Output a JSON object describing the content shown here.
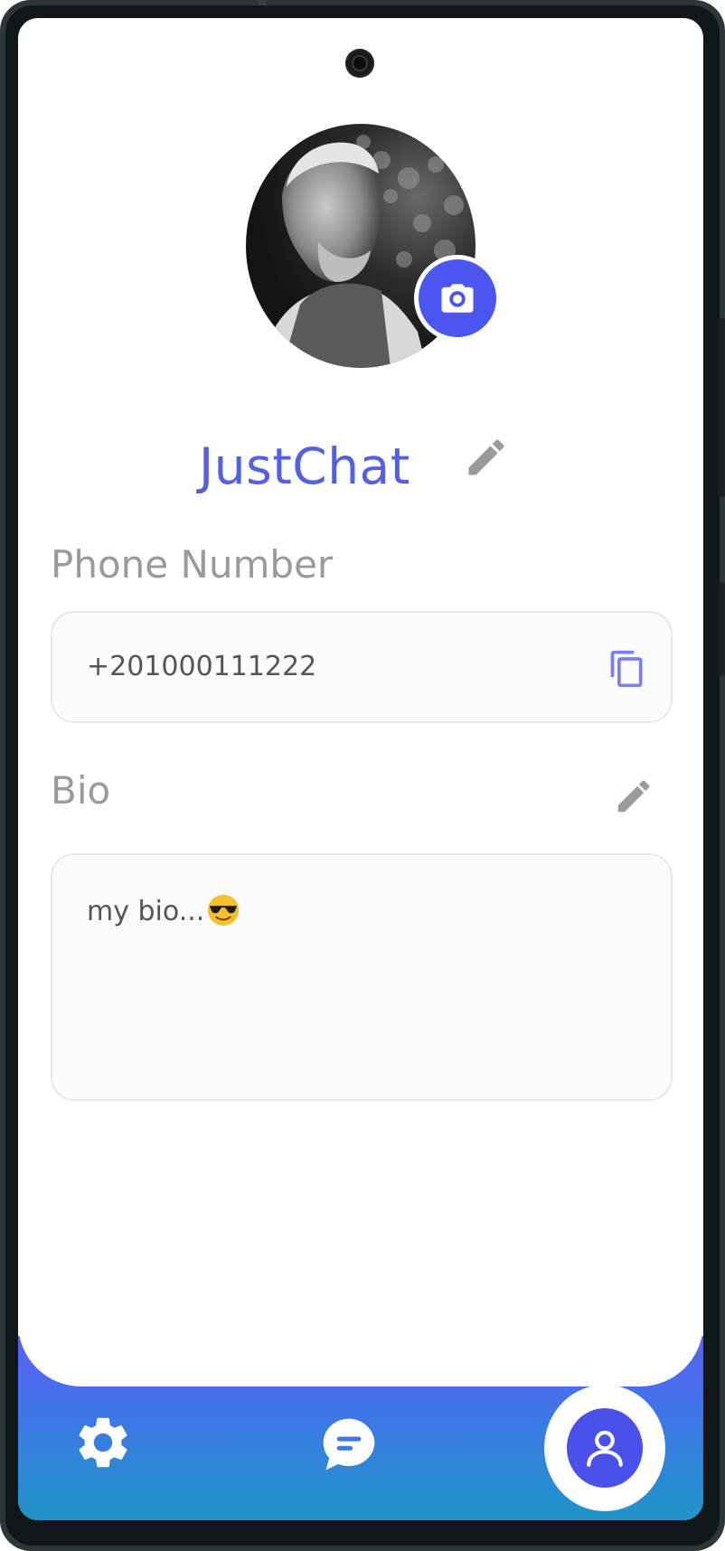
{
  "profile": {
    "name": "JustChat",
    "avatar_alt": "profile photo",
    "change_photo_icon": "camera-icon",
    "edit_name_icon": "pencil-icon"
  },
  "phone": {
    "label": "Phone Number",
    "value": "+201000111222",
    "copy_icon": "copy-icon"
  },
  "bio": {
    "label": "Bio",
    "value": "my bio...",
    "emoji": "😎",
    "edit_icon": "pencil-icon"
  },
  "nav": {
    "items": [
      {
        "icon": "gear-icon",
        "name": "settings"
      },
      {
        "icon": "chat-bubble-icon",
        "name": "chats"
      },
      {
        "icon": "person-icon",
        "name": "profile",
        "active": true
      }
    ]
  },
  "colors": {
    "accent": "#4b55f0",
    "name": "#5360e0",
    "label": "#9a9a9a",
    "nav_top": "#5b5ff6",
    "nav_bottom": "#1e95c8"
  }
}
